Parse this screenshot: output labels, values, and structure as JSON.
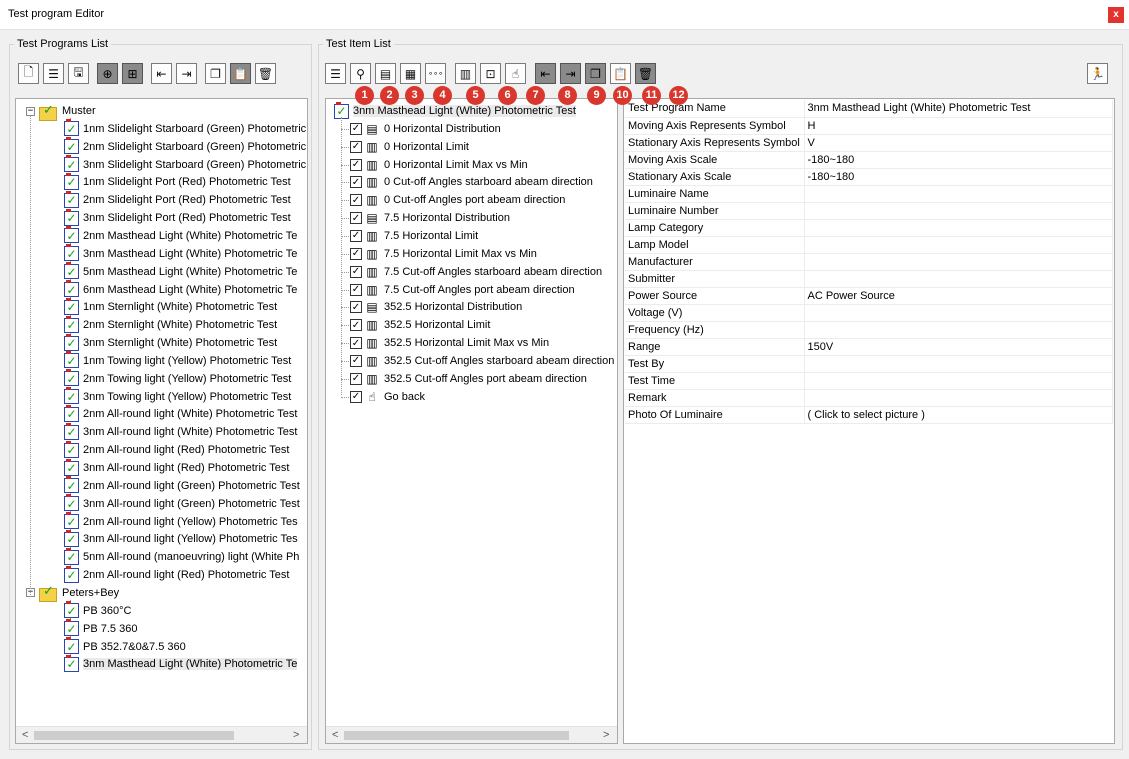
{
  "window": {
    "title": "Test program Editor",
    "close": "x"
  },
  "programs_group": {
    "legend": "Test Programs List"
  },
  "items_group": {
    "legend": "Test Item List"
  },
  "programs_toolbar": [
    {
      "name": "new-program-icon",
      "glyph": "🗋",
      "dark": false
    },
    {
      "name": "program-list-icon",
      "glyph": "☰",
      "dark": false
    },
    {
      "name": "save-icon",
      "glyph": "🖫",
      "dark": false
    },
    {
      "name": "add-group-icon",
      "glyph": "⊕",
      "dark": true
    },
    {
      "name": "add-subgroup-icon",
      "glyph": "⊞",
      "dark": true
    },
    {
      "name": "move-up-icon",
      "glyph": "⇤",
      "dark": false
    },
    {
      "name": "move-down-icon",
      "glyph": "⇥",
      "dark": false
    },
    {
      "name": "copy-icon",
      "glyph": "❐",
      "dark": false
    },
    {
      "name": "paste-icon",
      "glyph": "📋",
      "dark": true
    },
    {
      "name": "delete-icon",
      "glyph": "🗑",
      "dark": false
    }
  ],
  "items_toolbar": [
    {
      "name": "item-list-icon",
      "glyph": "☰",
      "dark": false,
      "badge": ""
    },
    {
      "name": "location-icon",
      "glyph": "⚲",
      "dark": false,
      "badge": "1"
    },
    {
      "name": "distribution-icon",
      "glyph": "▤",
      "dark": false,
      "badge": "2"
    },
    {
      "name": "grid-icon",
      "glyph": "▦",
      "dark": false,
      "badge": "3"
    },
    {
      "name": "dots-icon",
      "glyph": "∘∘∘",
      "dark": false,
      "badge": "4"
    },
    {
      "name": "calculator-icon",
      "glyph": "▥",
      "dark": false,
      "badge": "5"
    },
    {
      "name": "screen-icon",
      "glyph": "⊡",
      "dark": false,
      "badge": "6"
    },
    {
      "name": "hand-icon",
      "glyph": "☝",
      "dark": false,
      "badge": "7"
    },
    {
      "name": "move-up-icon",
      "glyph": "⇤",
      "dark": true,
      "badge": "8"
    },
    {
      "name": "move-down-icon",
      "glyph": "⇥",
      "dark": true,
      "badge": "9"
    },
    {
      "name": "copy-icon",
      "glyph": "❐",
      "dark": true,
      "badge": "10"
    },
    {
      "name": "paste-icon",
      "glyph": "📋",
      "dark": false,
      "badge": "11"
    },
    {
      "name": "delete-icon",
      "glyph": "🗑",
      "dark": true,
      "badge": "12"
    }
  ],
  "exit_button": {
    "glyph": "🏃"
  },
  "program_tree": {
    "groups": [
      {
        "name": "Muster",
        "items": [
          "1nm Slidelight Starboard (Green) Photometric",
          "2nm Slidelight Starboard (Green) Photometric",
          "3nm Slidelight Starboard (Green) Photometric",
          "1nm Slidelight Port (Red) Photometric Test",
          "2nm Slidelight Port (Red) Photometric Test",
          "3nm Slidelight Port (Red) Photometric Test",
          "2nm Masthead Light (White) Photometric Te",
          "3nm Masthead Light (White) Photometric Te",
          "5nm Masthead Light (White) Photometric Te",
          "6nm Masthead Light (White) Photometric Te",
          "1nm Sternlight  (White) Photometric Test",
          "2nm Sternlight  (White) Photometric Test",
          "3nm Sternlight  (White) Photometric Test",
          "1nm Towing light (Yellow) Photometric Test",
          "2nm Towing light (Yellow) Photometric Test",
          "3nm Towing light (Yellow) Photometric Test",
          "2nm All-round light (White) Photometric Test",
          "3nm All-round light (White) Photometric Test",
          "2nm All-round light (Red) Photometric Test",
          "3nm All-round light (Red) Photometric Test",
          "2nm All-round light (Green) Photometric Test",
          "3nm All-round light (Green) Photometric Test",
          "2nm All-round light (Yellow) Photometric Tes",
          "3nm All-round light (Yellow) Photometric Tes",
          "5nm All-round (manoeuvring) light (White Ph",
          "2nm All-round light (Red) Photometric Test"
        ]
      },
      {
        "name": "Peters+Bey",
        "items": [
          "PB 360°C",
          "PB 7.5 360",
          "PB 352.7&0&7.5  360",
          "3nm Masthead Light (White) Photometric Te"
        ]
      }
    ]
  },
  "item_tree": {
    "root": "3nm Masthead Light (White) Photometric Test",
    "items": [
      {
        "label": "0 Horizontal Distribution",
        "icon": "distribution-icon",
        "glyph": "▤"
      },
      {
        "label": "0 Horizontal Limit",
        "icon": "calculator-icon",
        "glyph": "▥"
      },
      {
        "label": "0 Horizontal Limit Max vs Min",
        "icon": "calculator-icon",
        "glyph": "▥"
      },
      {
        "label": "0 Cut-off Angles starboard abeam direction",
        "icon": "calculator-icon",
        "glyph": "▥"
      },
      {
        "label": "0 Cut-off Angles port abeam direction",
        "icon": "calculator-icon",
        "glyph": "▥"
      },
      {
        "label": "7.5 Horizontal Distribution",
        "icon": "distribution-icon",
        "glyph": "▤"
      },
      {
        "label": "7.5 Horizontal Limit",
        "icon": "calculator-icon",
        "glyph": "▥"
      },
      {
        "label": "7.5 Horizontal Limit Max vs Min",
        "icon": "calculator-icon",
        "glyph": "▥"
      },
      {
        "label": "7.5 Cut-off Angles starboard abeam direction",
        "icon": "calculator-icon",
        "glyph": "▥"
      },
      {
        "label": "7.5 Cut-off Angles port abeam direction",
        "icon": "calculator-icon",
        "glyph": "▥"
      },
      {
        "label": "352.5 Horizontal Distribution",
        "icon": "distribution-icon",
        "glyph": "▤"
      },
      {
        "label": "352.5 Horizontal Limit",
        "icon": "calculator-icon",
        "glyph": "▥"
      },
      {
        "label": "352.5 Horizontal Limit Max vs Min",
        "icon": "calculator-icon",
        "glyph": "▥"
      },
      {
        "label": "352.5 Cut-off Angles starboard abeam direction",
        "icon": "calculator-icon",
        "glyph": "▥"
      },
      {
        "label": "352.5 Cut-off Angles port abeam direction",
        "icon": "calculator-icon",
        "glyph": "▥"
      },
      {
        "label": "Go back",
        "icon": "hand-icon",
        "glyph": "☝"
      }
    ]
  },
  "properties": [
    {
      "key": "Test Program Name",
      "value": "3nm Masthead Light (White) Photometric Test"
    },
    {
      "key": "Moving Axis Represents Symbol",
      "value": "H"
    },
    {
      "key": "Stationary Axis Represents Symbol",
      "value": "V"
    },
    {
      "key": "Moving Axis Scale",
      "value": "-180~180"
    },
    {
      "key": "Stationary Axis Scale",
      "value": "-180~180"
    },
    {
      "key": "Luminaire Name",
      "value": ""
    },
    {
      "key": "Luminaire Number",
      "value": ""
    },
    {
      "key": "Lamp Category",
      "value": ""
    },
    {
      "key": "Lamp Model",
      "value": ""
    },
    {
      "key": "Manufacturer",
      "value": ""
    },
    {
      "key": "Submitter",
      "value": ""
    },
    {
      "key": "Power Source",
      "value": "AC Power Source"
    },
    {
      "key": "Voltage (V)",
      "value": ""
    },
    {
      "key": "Frequency (Hz)",
      "value": ""
    },
    {
      "key": "Range",
      "value": "150V"
    },
    {
      "key": "Test By",
      "value": ""
    },
    {
      "key": "Test Time",
      "value": ""
    },
    {
      "key": "Remark",
      "value": ""
    },
    {
      "key": "Photo Of Luminaire",
      "value": "( Click to select picture )"
    }
  ],
  "scroll": {
    "left_arrow": "<",
    "right_arrow": ">"
  }
}
